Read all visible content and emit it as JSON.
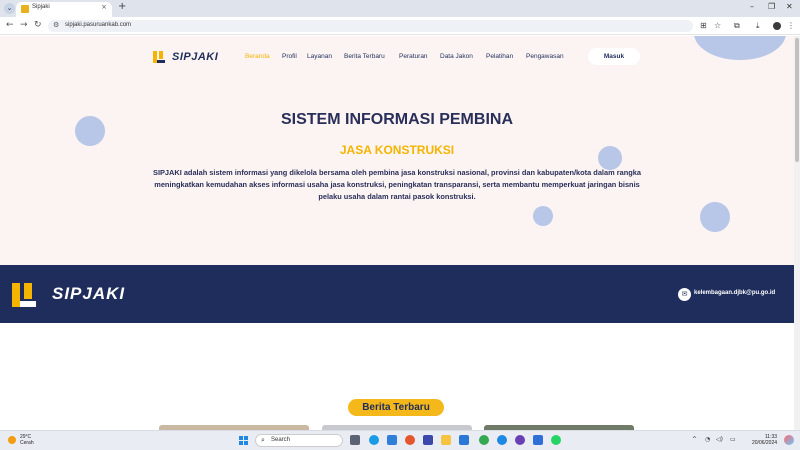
{
  "browser": {
    "tab_title": "Sipjaki",
    "url": "sipjaki.pasuruankab.com",
    "new_tab": "+",
    "tab_close": "×"
  },
  "site": {
    "logo_text": "SIPJAKI",
    "nav": [
      "Beranda",
      "Profil",
      "Layanan",
      "Berita Terbaru",
      "Peraturan",
      "Data Jakon",
      "Pelatihan",
      "Pengawasan"
    ],
    "login_label": "Masuk",
    "hero_title": "SISTEM INFORMASI PEMBINA",
    "hero_subtitle": "JASA KONSTRUKSI",
    "hero_description": "SIPJAKI adalah sistem informasi yang dikelola bersama oleh pembina jasa konstruksi nasional, provinsi dan kabupaten/kota dalam rangka meningkatkan kemudahan akses informasi usaha jasa konstruksi, peningkatan transparansi, serta membantu memperkuat jaringan bisnis pelaku usaha dalam rantai pasok konstruksi.",
    "footer_logo_text": "SIPJAKI",
    "footer_email": "kelembagaan.djbk@pu.go.id",
    "section_button": "Berita Terbaru"
  },
  "taskbar": {
    "weather_temp": "29°C",
    "weather_desc": "Cerah",
    "search_label": "Search",
    "time": "11:33",
    "date": "20/06/2024"
  },
  "colors": {
    "navy": "#1f2d5c",
    "gold": "#f4b400",
    "hero_bg": "#fbf4f2",
    "circle": "#b8c6e8"
  }
}
